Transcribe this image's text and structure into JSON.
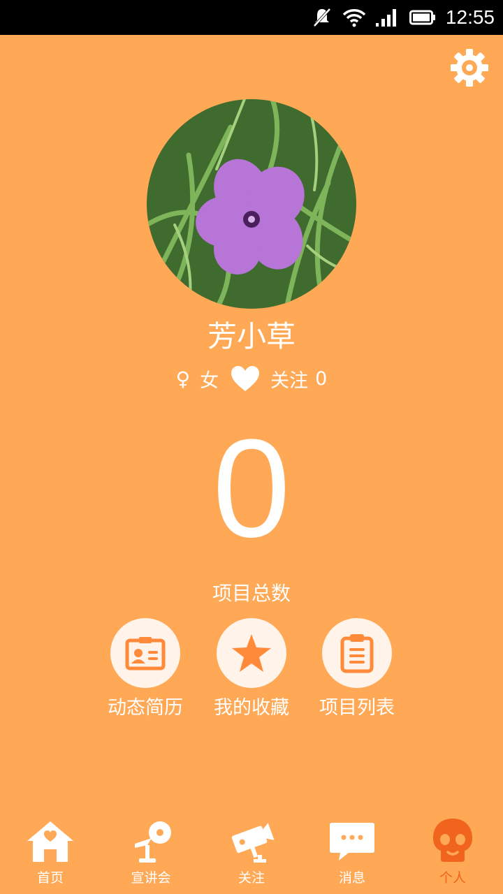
{
  "status_bar": {
    "time": "12:55"
  },
  "profile": {
    "name": "芳小草",
    "gender_symbol": "♀",
    "gender": "女",
    "follow_label": "关注",
    "follow_count": "0"
  },
  "stats": {
    "project_total": "0",
    "project_total_label": "项目总数"
  },
  "actions": [
    {
      "label": "动态简历",
      "icon": "resume-card-icon"
    },
    {
      "label": "我的收藏",
      "icon": "star-icon"
    },
    {
      "label": "项目列表",
      "icon": "clipboard-icon"
    }
  ],
  "tabs": [
    {
      "label": "首页",
      "icon": "home-heart-icon",
      "active": false
    },
    {
      "label": "宣讲会",
      "icon": "microphone-icon",
      "active": false
    },
    {
      "label": "关注",
      "icon": "camera-icon",
      "active": false
    },
    {
      "label": "消息",
      "icon": "chat-bubble-icon",
      "active": false
    },
    {
      "label": "个人",
      "icon": "skull-icon",
      "active": true
    }
  ],
  "colors": {
    "background": "#FFA855",
    "accent": "#F0641E",
    "icon_circle": "#FFF3EA"
  }
}
